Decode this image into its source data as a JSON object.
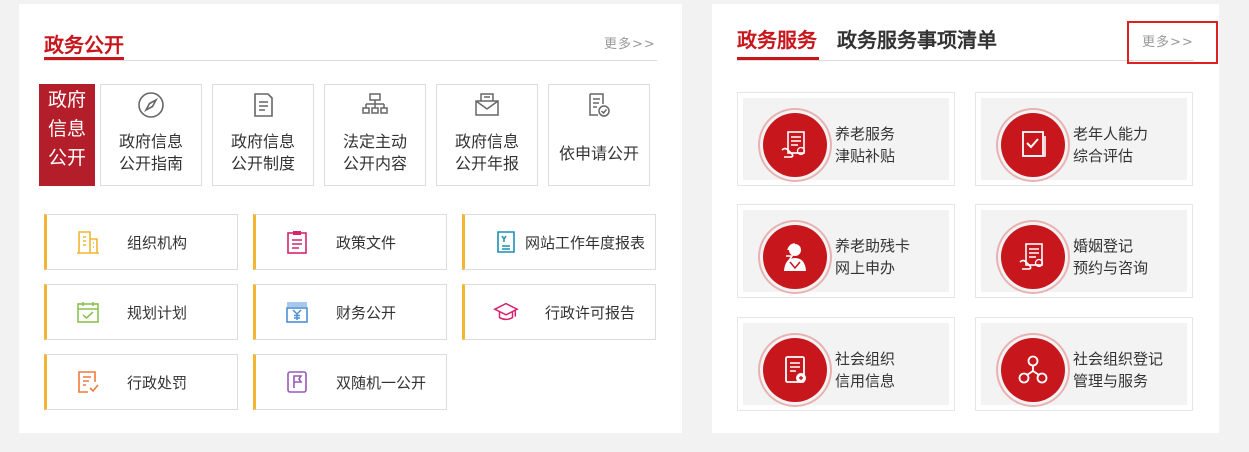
{
  "left": {
    "title": "政务公开",
    "more": "更多>>",
    "head_label": [
      "政府",
      "信息",
      "公开"
    ],
    "nav": [
      {
        "label": "政府信息\n公开指南",
        "icon": "compass-icon"
      },
      {
        "label": "政府信息\n公开制度",
        "icon": "document-icon"
      },
      {
        "label": "法定主动\n公开内容",
        "icon": "org-chart-icon"
      },
      {
        "label": "政府信息\n公开年报",
        "icon": "mail-report-icon"
      },
      {
        "label": "依申请公开",
        "icon": "check-document-icon"
      }
    ],
    "items": [
      {
        "label": "组织机构",
        "icon": "building-icon",
        "color": "#f2b632"
      },
      {
        "label": "政策文件",
        "icon": "clipboard-icon",
        "color": "#d6246e"
      },
      {
        "label": "网站工作年度报表",
        "icon": "report-icon",
        "color": "#1b8fb5"
      },
      {
        "label": "规划计划",
        "icon": "calendar-icon",
        "color": "#8cc152"
      },
      {
        "label": "财务公开",
        "icon": "finance-icon",
        "color": "#4a90d9"
      },
      {
        "label": "行政许可报告",
        "icon": "graduation-cap-icon",
        "color": "#d6246e"
      },
      {
        "label": "行政处罚",
        "icon": "penalty-doc-icon",
        "color": "#f07a3a"
      },
      {
        "label": "双随机一公开",
        "icon": "flag-doc-icon",
        "color": "#9b59b6"
      }
    ]
  },
  "right": {
    "tab_active": "政务服务",
    "tab_inactive": "政务服务事项清单",
    "more": "更多>>",
    "services": [
      {
        "label": "养老服务\n津贴补贴",
        "icon": "hand-document-icon"
      },
      {
        "label": "老年人能力\n综合评估",
        "icon": "check-book-icon"
      },
      {
        "label": "养老助残卡\n网上申办",
        "icon": "person-icon"
      },
      {
        "label": "婚姻登记\n预约与咨询",
        "icon": "hand-document-icon"
      },
      {
        "label": "社会组织\n信用信息",
        "icon": "credit-doc-icon"
      },
      {
        "label": "社会组织登记\n管理与服务",
        "icon": "network-icon"
      }
    ]
  }
}
